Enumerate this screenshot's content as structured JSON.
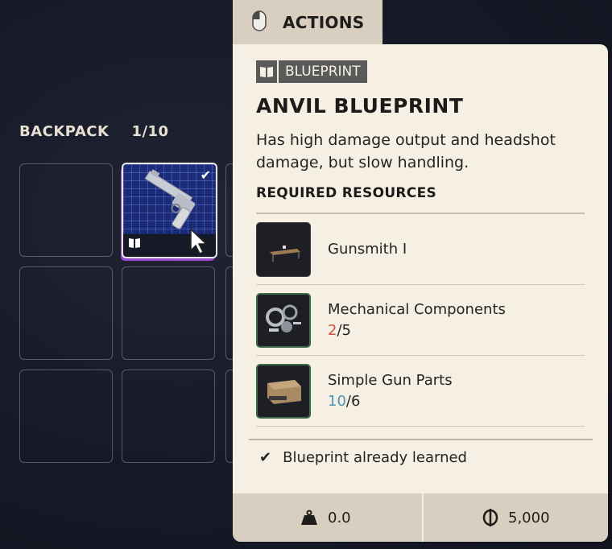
{
  "backpack": {
    "label": "BACKPACK",
    "count": "1/10"
  },
  "actions_tab": {
    "label": "ACTIONS",
    "icon": "mouse-icon"
  },
  "item": {
    "tag": "BLUEPRINT",
    "title": "ANVIL BLUEPRINT",
    "description": "Has high damage output and headshot damage, but slow handling.",
    "required_label": "REQUIRED RESOURCES",
    "resources": [
      {
        "name": "Gunsmith I",
        "have": "",
        "need": ""
      },
      {
        "name": "Mechanical Components",
        "have": "2",
        "need": "/5"
      },
      {
        "name": "Simple Gun Parts",
        "have": "10",
        "need": "/6"
      }
    ],
    "learned": "Blueprint already learned"
  },
  "footer": {
    "weight": "0.0",
    "value": "5,000"
  },
  "colors": {
    "panel": "#f5efe4",
    "tab": "#d8cfc0",
    "insufficient": "#d0513f",
    "sufficient": "#4d96b3",
    "slot_highlight": "#1d2c7a"
  }
}
